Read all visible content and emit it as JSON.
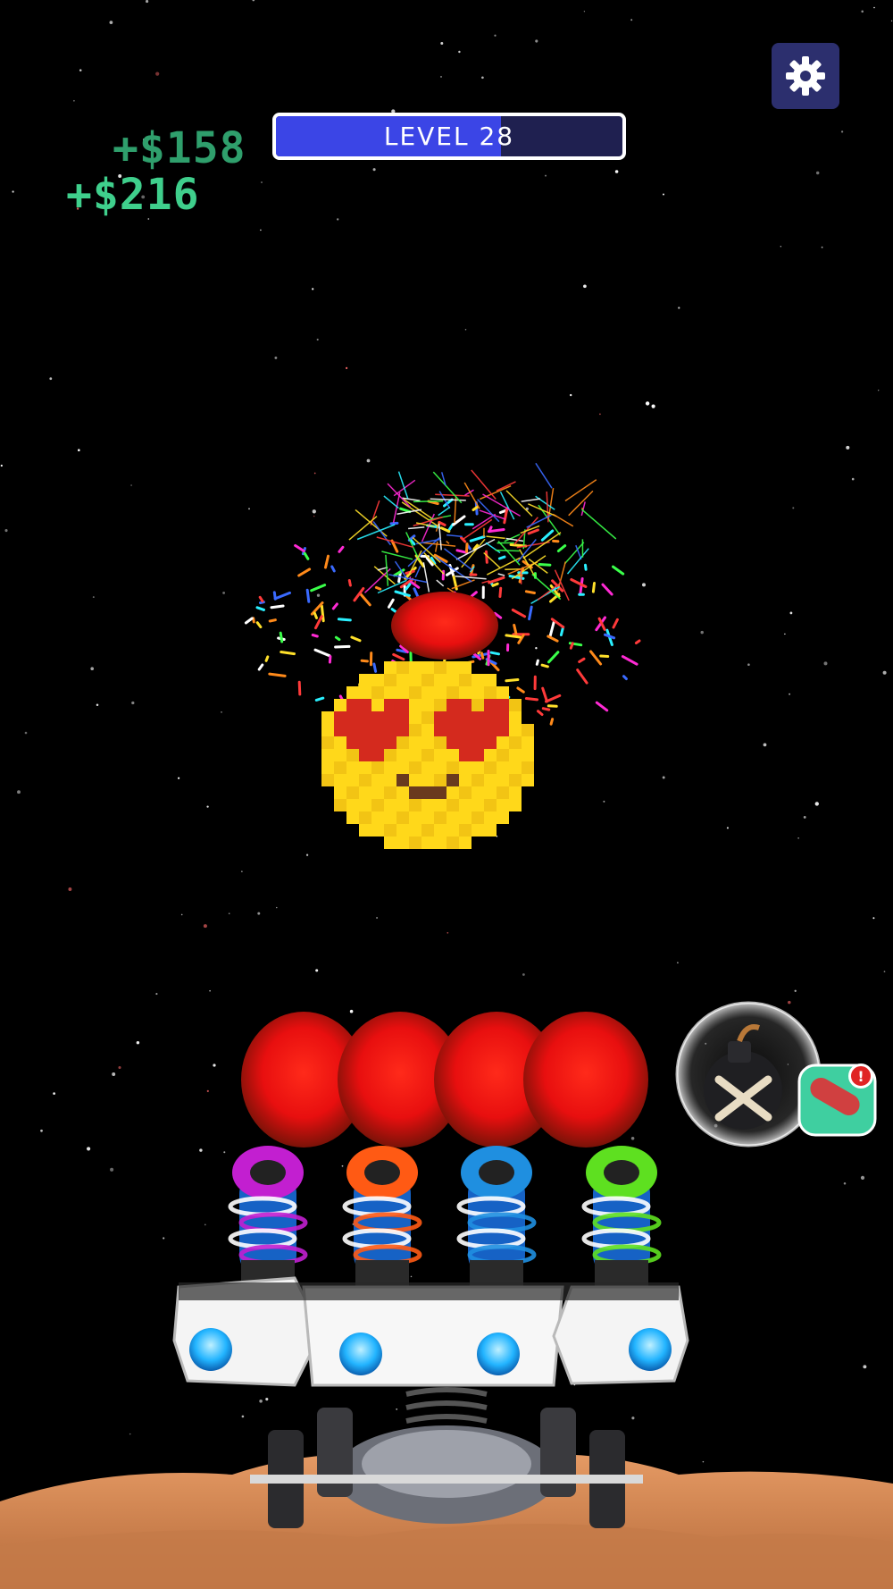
{
  "hud": {
    "level_label": "LEVEL 28",
    "level_progress": 0.65,
    "settings_icon": "gear-icon"
  },
  "rewards": [
    {
      "text": "+$158"
    },
    {
      "text": "+$216"
    }
  ],
  "powerup": {
    "icon": "bomb-icon",
    "badge_icon": "alert-icon",
    "badge_text": "!"
  },
  "target": {
    "description_icon": "heart-eyes-emoji"
  },
  "ammo_queue": {
    "count": 4,
    "color": "#ff1010"
  },
  "cannons": [
    {
      "color": "#c21fd0",
      "accent": "#3a6ff0"
    },
    {
      "color": "#ff5a14",
      "accent": "#3a6ff0"
    },
    {
      "color": "#1f8fe0",
      "accent": "#3a6ff0"
    },
    {
      "color": "#5ee020",
      "accent": "#3a6ff0"
    }
  ],
  "colors": {
    "background": "#000000",
    "level_fill": "#3b45e6",
    "level_track": "#1f2050",
    "ground": "#d98a55"
  }
}
